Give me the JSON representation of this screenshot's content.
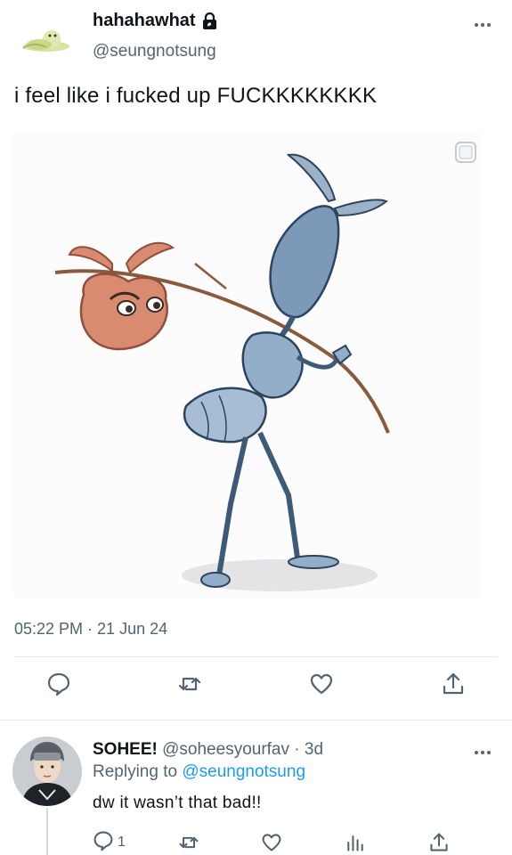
{
  "tweet": {
    "display_name": "hahahawhat",
    "handle": "@seungnotsung",
    "text": "i feel like i fucked up FUCKKKKKKKK",
    "timestamp": "05:22 PM · 21 Jun 24",
    "icons": {
      "avatar": "green-blob-avatar",
      "verified": "lock-icon",
      "more": "more-icon"
    },
    "media": {
      "image_subject": "illustration-ant-with-bindle",
      "badge": "alt-text-icon"
    },
    "actions": [
      "reply-icon",
      "retweet-icon",
      "like-icon",
      "share-icon"
    ]
  },
  "reply": {
    "display_name": "SOHEE!",
    "handle_meta": " @soheesyourfav · 3d",
    "replying_prefix": "Replying to ",
    "replying_handle": "@seungnotsung",
    "text": "dw it wasn’t that bad!!",
    "reply_count": "1",
    "actions": [
      "reply-icon",
      "retweet-icon",
      "like-icon",
      "views-icon",
      "share-icon"
    ]
  },
  "colors": {
    "text": "#0f1419",
    "secondary": "#536471",
    "link": "#1d9bf0",
    "divider": "#e6e9eb"
  }
}
